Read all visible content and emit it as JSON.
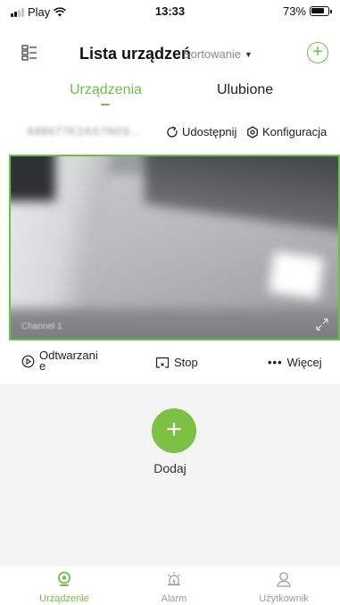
{
  "status_bar": {
    "carrier": "Play",
    "time": "13:33",
    "battery": "73%"
  },
  "header": {
    "title": "Lista urządzeń",
    "sort_label": "Sortowanie"
  },
  "tabs": [
    {
      "label": "Urządzenia",
      "active": true
    },
    {
      "label": "Ulubione",
      "active": false
    }
  ],
  "device": {
    "id_blurred": "A88677E2AS7N0S...",
    "share_label": "Udostępnij",
    "config_label": "Konfiguracja"
  },
  "video": {
    "channel_blurred": "Channel 1"
  },
  "controls": {
    "playback_label": "Odtwarzani e",
    "stop_label": "Stop",
    "more_label": "Więcej"
  },
  "add": {
    "label": "Dodaj"
  },
  "bottom_nav": [
    {
      "label": "Urządzenie",
      "icon": "camera-icon",
      "active": true
    },
    {
      "label": "Alarm",
      "icon": "alarm-icon",
      "active": false
    },
    {
      "label": "Użytkownik",
      "icon": "user-icon",
      "active": false
    }
  ],
  "colors": {
    "accent": "#6cc04a",
    "add_button": "#7cc144"
  }
}
